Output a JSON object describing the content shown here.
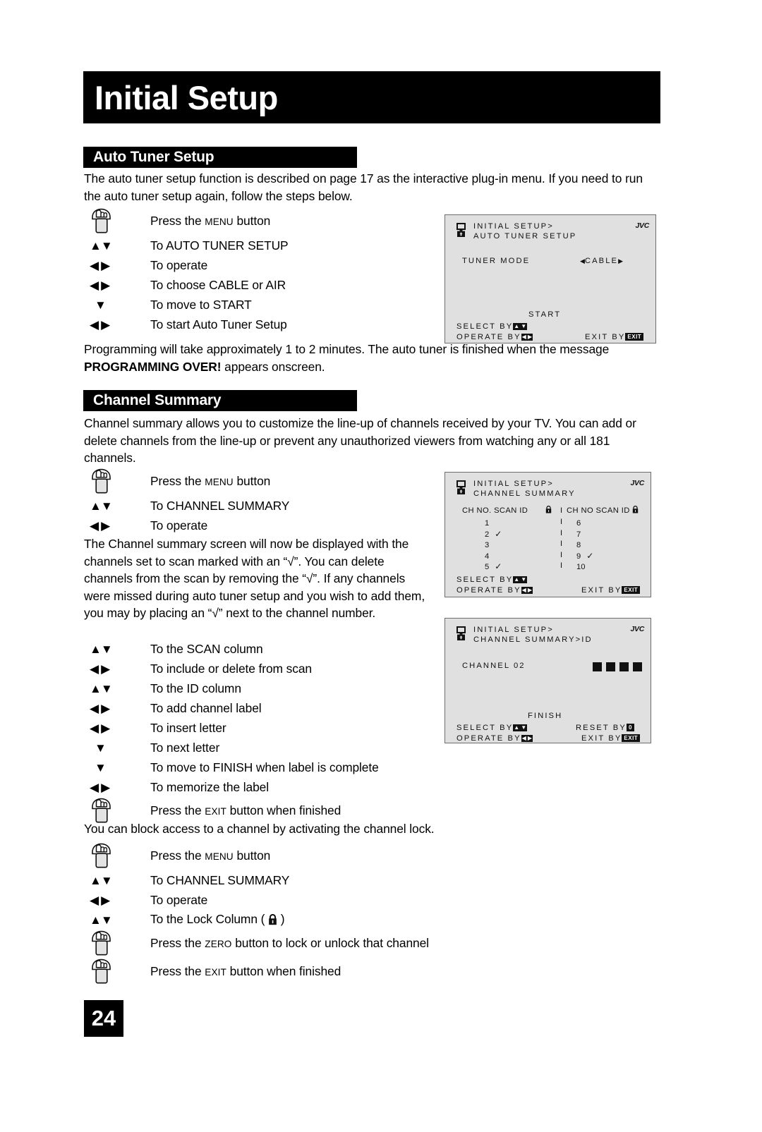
{
  "document": {
    "title": "Initial Setup",
    "page_number": "24"
  },
  "sections": [
    {
      "id": "auto_tuner",
      "heading": "Auto Tuner Setup"
    },
    {
      "id": "channel_summary",
      "heading": "Channel Summary"
    }
  ],
  "paragraphs": {
    "p1": "The auto tuner setup function is described on page 17 as the interactive plug-in menu.  If you need to run the auto tuner setup again, follow the steps below.",
    "p2_a": "Programming will take approximately 1 to 2 minutes.  The auto tuner is finished when the message ",
    "p2_bold": "PROGRAMMING OVER!",
    "p2_b": " appears onscreen.",
    "p3": "Channel summary allows you to customize the line-up of channels received by your TV. You can add or delete channels from the line-up or prevent any unauthorized viewers from watching any or all 181 channels.",
    "p4": "The Channel summary screen will now be displayed with the channels set to scan marked with an “√”. You can delete channels from the scan by removing the “√”. If any channels were missed during auto tuner setup and you wish to add them, you may by placing an “√” next to the channel number.",
    "p5": "You can block access to a channel by activating the channel lock."
  },
  "steps_auto_tuner": [
    {
      "icon": "hand-button-icon",
      "pre": "Press the ",
      "sc": "Menu",
      "post": " button"
    },
    {
      "icon": "up-down-arrows-icon",
      "pre": "To AUTO TUNER SETUP",
      "sc": "",
      "post": ""
    },
    {
      "icon": "left-right-arrows-icon",
      "pre": "To operate",
      "sc": "",
      "post": ""
    },
    {
      "icon": "left-right-arrows-icon",
      "pre": "To choose CABLE or AIR",
      "sc": "",
      "post": ""
    },
    {
      "icon": "down-arrow-icon",
      "pre": "To move to START",
      "sc": "",
      "post": ""
    },
    {
      "icon": "left-right-arrows-icon",
      "pre": "To start Auto Tuner Setup",
      "sc": "",
      "post": ""
    }
  ],
  "steps_channel_summary_a": [
    {
      "icon": "hand-button-icon",
      "pre": "Press the ",
      "sc": "Menu",
      "post": " button"
    },
    {
      "icon": "up-down-arrows-icon",
      "pre": "To CHANNEL SUMMARY",
      "sc": "",
      "post": ""
    },
    {
      "icon": "left-right-arrows-icon",
      "pre": "To operate",
      "sc": "",
      "post": ""
    }
  ],
  "steps_channel_summary_b": [
    {
      "icon": "up-down-arrows-icon",
      "pre": "To the SCAN column",
      "sc": "",
      "post": ""
    },
    {
      "icon": "left-right-arrows-icon",
      "pre": "To include or delete from scan",
      "sc": "",
      "post": ""
    },
    {
      "icon": "up-down-arrows-icon",
      "pre": "To the ID column",
      "sc": "",
      "post": ""
    },
    {
      "icon": "left-right-arrows-icon",
      "pre": "To add channel label",
      "sc": "",
      "post": ""
    },
    {
      "icon": "left-right-arrows-icon",
      "pre": "To insert letter",
      "sc": "",
      "post": ""
    },
    {
      "icon": "down-arrow-icon",
      "pre": "To next letter",
      "sc": "",
      "post": ""
    },
    {
      "icon": "down-arrow-icon",
      "pre": "To move to FINISH when label is complete",
      "sc": "",
      "post": ""
    },
    {
      "icon": "left-right-arrows-icon",
      "pre": "To memorize the label",
      "sc": "",
      "post": ""
    },
    {
      "icon": "hand-button-icon",
      "pre": "Press the ",
      "sc": "Exit",
      "post": " button when finished"
    }
  ],
  "steps_channel_lock": [
    {
      "icon": "hand-button-icon",
      "pre": "Press the ",
      "sc": "Menu",
      "post": " button"
    },
    {
      "icon": "up-down-arrows-icon",
      "pre": "To CHANNEL SUMMARY",
      "sc": "",
      "post": ""
    },
    {
      "icon": "left-right-arrows-icon",
      "pre": "To operate",
      "sc": "",
      "post": ""
    },
    {
      "icon": "up-down-arrows-icon",
      "pre": "To the Lock Column ( ",
      "sc": "",
      "post": " )",
      "has_lock": true
    },
    {
      "icon": "hand-button-icon",
      "pre": "Press the ",
      "sc": "Zero",
      "post": " button to lock or unlock that channel"
    },
    {
      "icon": "hand-button-icon",
      "pre": "Press the ",
      "sc": "Exit",
      "post": " button when finished"
    }
  ],
  "osd1": {
    "brand": "JVC",
    "line1": "INITIAL SETUP>",
    "line2": "AUTO TUNER SETUP",
    "setting_label": "TUNER MODE",
    "setting_value": "CABLE",
    "start_label": "START",
    "select_by": "SELECT   BY",
    "operate_by": "OPERATE BY",
    "exit_by": "EXIT BY",
    "exit_key": "EXIT"
  },
  "osd2": {
    "brand": "JVC",
    "line1": "INITIAL SETUP>",
    "line2": "CHANNEL SUMMARY",
    "col_header_left": "CH NO. SCAN ID",
    "col_header_right": "CH NO SCAN ID",
    "left_rows": [
      {
        "ch": "1",
        "scan": ""
      },
      {
        "ch": "2",
        "scan": "✓"
      },
      {
        "ch": "3",
        "scan": ""
      },
      {
        "ch": "4",
        "scan": ""
      },
      {
        "ch": "5",
        "scan": "✓"
      }
    ],
    "right_rows": [
      {
        "ch": "6",
        "scan": ""
      },
      {
        "ch": "7",
        "scan": ""
      },
      {
        "ch": "8",
        "scan": ""
      },
      {
        "ch": "9",
        "scan": "✓"
      },
      {
        "ch": "10",
        "scan": ""
      }
    ],
    "select_by": "SELECT   BY",
    "operate_by": "OPERATE BY",
    "exit_by": "EXIT BY",
    "exit_key": "EXIT"
  },
  "osd3": {
    "brand": "JVC",
    "line1": "INITIAL SETUP>",
    "line2": "CHANNEL SUMMARY>ID",
    "channel_label": "CHANNEL  02",
    "finish_label": "FINISH",
    "select_by": "SELECT   BY",
    "operate_by": "OPERATE BY",
    "reset_by": "RESET BY",
    "reset_key": "0",
    "exit_by": "EXIT BY",
    "exit_key": "EXIT"
  },
  "colors": {
    "heading_bg": "#000000",
    "heading_fg": "#ffffff",
    "osd_bg": "#e0e0e0",
    "osd_border": "#6d6d6d",
    "page_bg": "#ffffff"
  }
}
